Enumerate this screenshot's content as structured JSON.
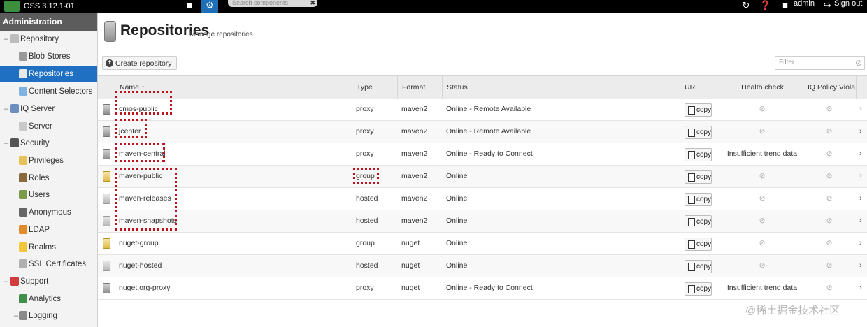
{
  "topbar": {
    "version": "OSS 3.12.1-01",
    "search_placeholder": "Search components",
    "user": "admin",
    "signout": "Sign out",
    "icons": [
      "box-icon",
      "gear-icon",
      "refresh-icon",
      "help-icon",
      "user-icon",
      "signout-icon"
    ]
  },
  "sidebar": {
    "header": "Administration",
    "items": [
      {
        "label": "Repository",
        "icon": "repository-icon",
        "toggle": "–"
      },
      {
        "label": "Blob Stores",
        "icon": "blob-stores-icon"
      },
      {
        "label": "Repositories",
        "icon": "repositories-icon",
        "selected": true
      },
      {
        "label": "Content Selectors",
        "icon": "content-selectors-icon"
      },
      {
        "label": "IQ Server",
        "icon": "iq-server-icon",
        "toggle": "–"
      },
      {
        "label": "Server",
        "icon": "server-icon"
      },
      {
        "label": "Security",
        "icon": "security-icon",
        "toggle": "–"
      },
      {
        "label": "Privileges",
        "icon": "privileges-icon"
      },
      {
        "label": "Roles",
        "icon": "roles-icon"
      },
      {
        "label": "Users",
        "icon": "users-icon"
      },
      {
        "label": "Anonymous",
        "icon": "anonymous-icon"
      },
      {
        "label": "LDAP",
        "icon": "ldap-icon"
      },
      {
        "label": "Realms",
        "icon": "realms-icon"
      },
      {
        "label": "SSL Certificates",
        "icon": "ssl-certificates-icon"
      },
      {
        "label": "Support",
        "icon": "support-icon",
        "toggle": "–"
      },
      {
        "label": "Analytics",
        "icon": "analytics-icon"
      },
      {
        "label": "Logging",
        "icon": "logging-icon",
        "toggle": "–"
      }
    ]
  },
  "page": {
    "title": "Repositories",
    "subtitle": "Manage repositories",
    "create_label": "Create repository",
    "filter_placeholder": "Filter"
  },
  "table": {
    "columns": [
      "Name",
      "Type",
      "Format",
      "Status",
      "URL",
      "Health check",
      "IQ Policy Viola..."
    ],
    "copy_label": "copy",
    "empty_mark": "⊘",
    "rows": [
      {
        "name": "cmos-public",
        "type": "proxy",
        "format": "maven2",
        "status": "Online - Remote Available",
        "health": "",
        "icon": "proxy"
      },
      {
        "name": "jcenter",
        "type": "proxy",
        "format": "maven2",
        "status": "Online - Remote Available",
        "health": "",
        "icon": "proxy"
      },
      {
        "name": "maven-central",
        "type": "proxy",
        "format": "maven2",
        "status": "Online - Ready to Connect",
        "health": "Insufficient trend data",
        "icon": "proxy"
      },
      {
        "name": "maven-public",
        "type": "group",
        "format": "maven2",
        "status": "Online",
        "health": "",
        "icon": "group"
      },
      {
        "name": "maven-releases",
        "type": "hosted",
        "format": "maven2",
        "status": "Online",
        "health": "",
        "icon": "hosted"
      },
      {
        "name": "maven-snapshots",
        "type": "hosted",
        "format": "maven2",
        "status": "Online",
        "health": "",
        "icon": "hosted"
      },
      {
        "name": "nuget-group",
        "type": "group",
        "format": "nuget",
        "status": "Online",
        "health": "",
        "icon": "group"
      },
      {
        "name": "nuget-hosted",
        "type": "hosted",
        "format": "nuget",
        "status": "Online",
        "health": "",
        "icon": "hosted"
      },
      {
        "name": "nuget.org-proxy",
        "type": "proxy",
        "format": "nuget",
        "status": "Online - Ready to Connect",
        "health": "Insufficient trend data",
        "icon": "proxy"
      }
    ]
  },
  "annotation_color": "#c0111c",
  "watermark": "@稀土掘金技术社区"
}
